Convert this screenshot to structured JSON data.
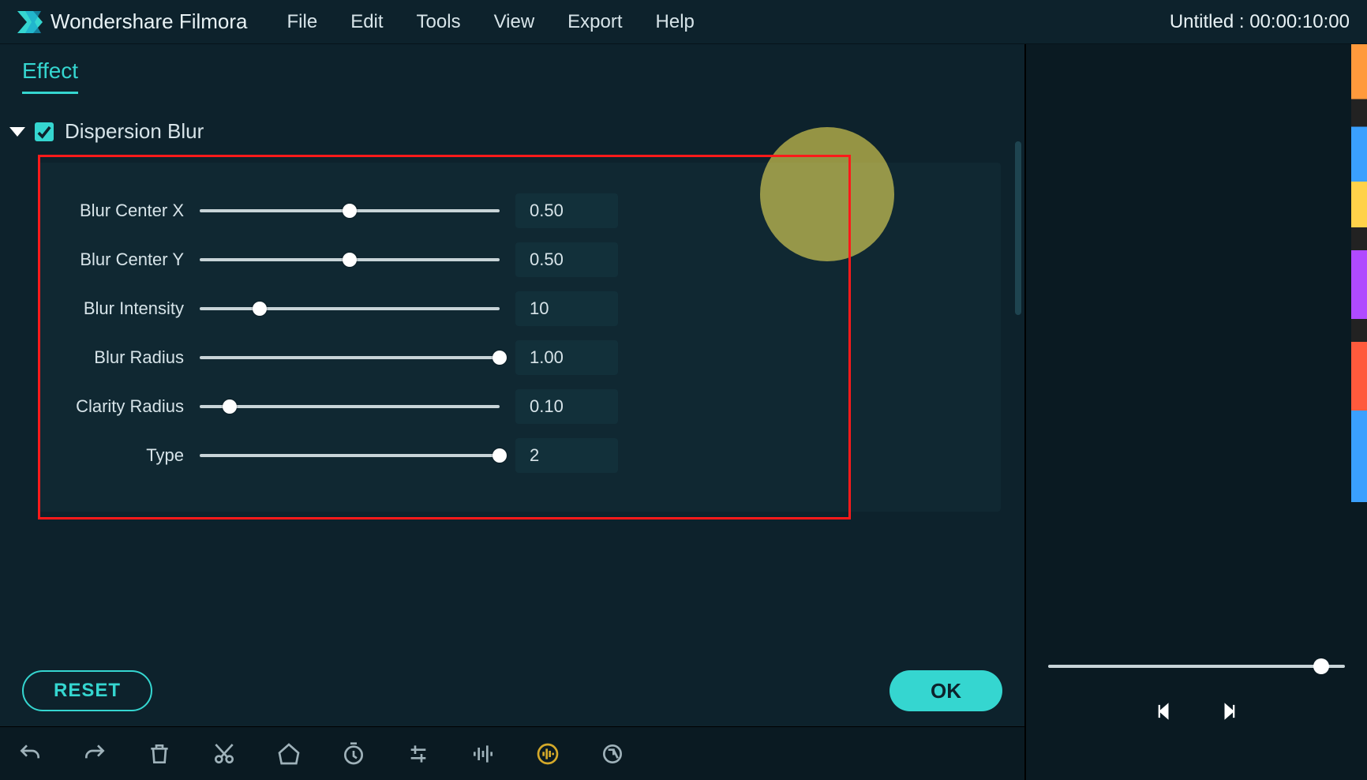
{
  "app_title": "Wondershare Filmora",
  "menu": [
    "File",
    "Edit",
    "Tools",
    "View",
    "Export",
    "Help"
  ],
  "project_title": "Untitled : 00:00:10:00",
  "tab_label": "Effect",
  "section": {
    "title": "Dispersion Blur",
    "checked": true
  },
  "params": [
    {
      "label": "Blur Center X",
      "value_text": "0.50",
      "pos": 0.5
    },
    {
      "label": "Blur Center Y",
      "value_text": "0.50",
      "pos": 0.5
    },
    {
      "label": "Blur Intensity",
      "value_text": "10",
      "pos": 0.2
    },
    {
      "label": "Blur Radius",
      "value_text": "1.00",
      "pos": 1.0
    },
    {
      "label": "Clarity Radius",
      "value_text": "0.10",
      "pos": 0.1
    },
    {
      "label": "Type",
      "value_text": "2",
      "pos": 1.0
    }
  ],
  "buttons": {
    "reset": "RESET",
    "ok": "OK"
  },
  "toolbar_icons": [
    "undo",
    "redo",
    "delete",
    "cut",
    "tag",
    "timer",
    "adjust",
    "audio-bars",
    "audio-enhance",
    "motion-tracking"
  ]
}
